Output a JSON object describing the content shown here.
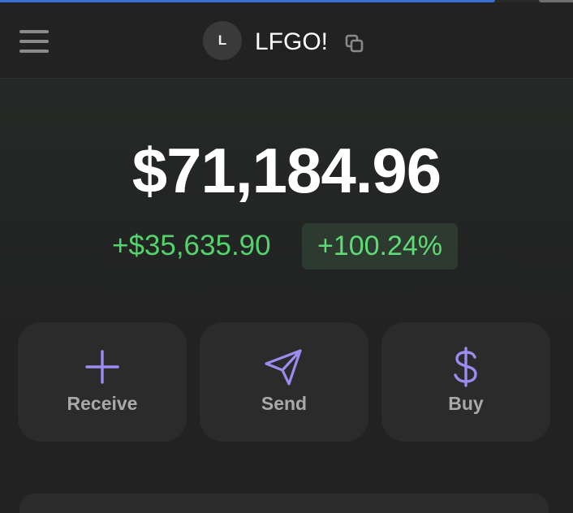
{
  "header": {
    "avatar_initial": "L",
    "account_name": "LFGO!",
    "menu_icon": "hamburger-menu-icon",
    "copy_icon": "copy-icon"
  },
  "portfolio": {
    "balance": "$71,184.96",
    "change_amount": "+$35,635.90",
    "change_percent": "+100.24%"
  },
  "actions": [
    {
      "label": "Receive",
      "icon": "plus-icon"
    },
    {
      "label": "Send",
      "icon": "paper-plane-icon"
    },
    {
      "label": "Buy",
      "icon": "dollar-icon"
    }
  ],
  "colors": {
    "accent_purple": "#9b8cf0",
    "positive_green": "#53d36b",
    "positive_badge_bg": "#2c3a2f",
    "card_bg": "#2b2b2b"
  }
}
